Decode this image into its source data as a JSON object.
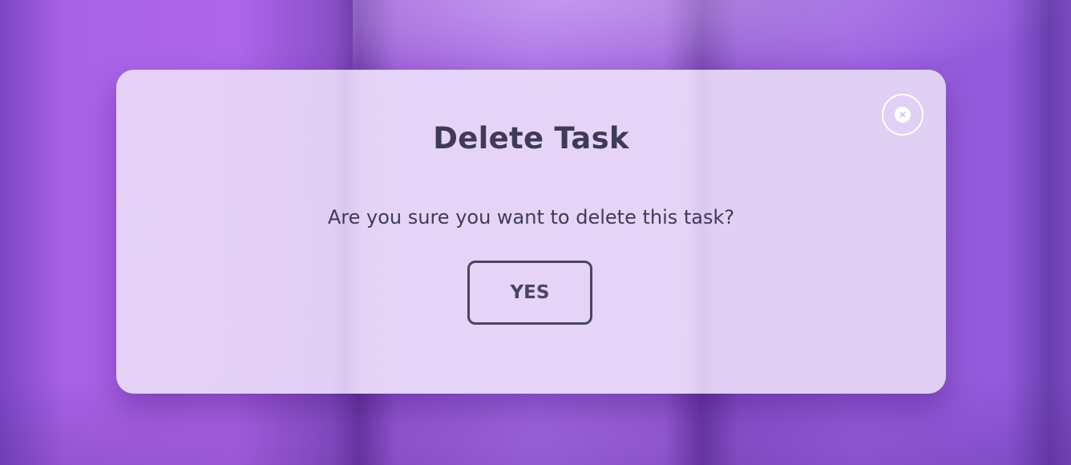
{
  "dialog": {
    "title": "Delete Task",
    "message": "Are you sure you want to delete this task?",
    "confirm_label": "YES",
    "close_icon": "close-circle-icon"
  },
  "colors": {
    "background": "#a862e6",
    "dialog_surface": "#e8d8f8",
    "text": "#3f3a57",
    "button_border": "#4a4463",
    "close_icon": "#ffffff"
  }
}
